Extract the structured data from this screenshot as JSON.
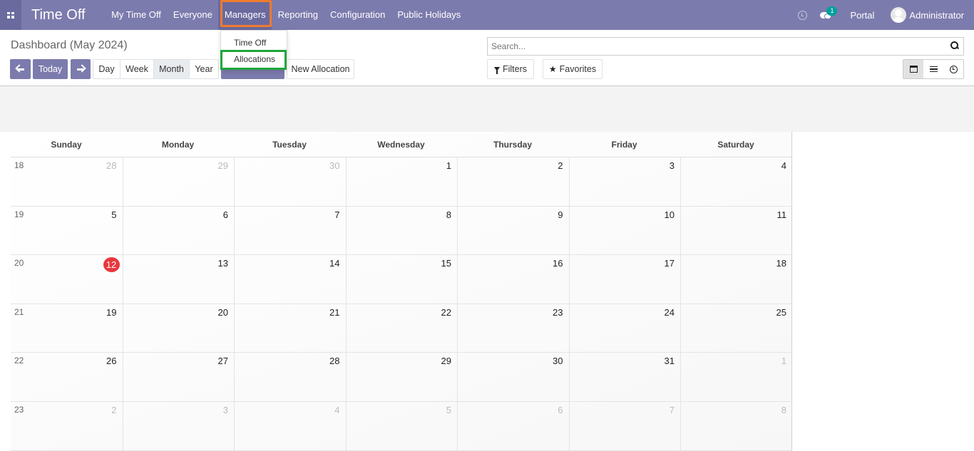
{
  "app": {
    "title": "Time Off"
  },
  "nav": {
    "menu": [
      "My Time Off",
      "Everyone",
      "Managers",
      "Reporting",
      "Configuration",
      "Public Holidays"
    ],
    "chat_count": "1",
    "portal": "Portal",
    "user": "Administrator"
  },
  "managers_menu": {
    "items": [
      "Time Off",
      "Allocations"
    ]
  },
  "control": {
    "breadcrumb": "Dashboard (May 2024)",
    "today": "Today",
    "scales": [
      "Day",
      "Week",
      "Month",
      "Year"
    ],
    "active_scale": "Month",
    "new_allocation": "New Allocation",
    "search_placeholder": "Search...",
    "filters": "Filters",
    "favorites": "Favorites"
  },
  "colors": {
    "nav": "#7c7bad",
    "today": "#e8373d",
    "managers_highlight": "#f07b2c",
    "allocations_highlight": "#1ea63a"
  },
  "calendar": {
    "day_names": [
      "Sunday",
      "Monday",
      "Tuesday",
      "Wednesday",
      "Thursday",
      "Friday",
      "Saturday"
    ],
    "today": "12",
    "weeks": [
      {
        "week": "18",
        "days": [
          "28",
          "29",
          "30",
          "1",
          "2",
          "3",
          "4"
        ],
        "muted": [
          true,
          true,
          true,
          false,
          false,
          false,
          false
        ]
      },
      {
        "week": "19",
        "days": [
          "5",
          "6",
          "7",
          "8",
          "9",
          "10",
          "11"
        ],
        "muted": [
          false,
          false,
          false,
          false,
          false,
          false,
          false
        ]
      },
      {
        "week": "20",
        "days": [
          "12",
          "13",
          "14",
          "15",
          "16",
          "17",
          "18"
        ],
        "muted": [
          false,
          false,
          false,
          false,
          false,
          false,
          false
        ]
      },
      {
        "week": "21",
        "days": [
          "19",
          "20",
          "21",
          "22",
          "23",
          "24",
          "25"
        ],
        "muted": [
          false,
          false,
          false,
          false,
          false,
          false,
          false
        ]
      },
      {
        "week": "22",
        "days": [
          "26",
          "27",
          "28",
          "29",
          "30",
          "31",
          "1"
        ],
        "muted": [
          false,
          false,
          false,
          false,
          false,
          false,
          true
        ]
      },
      {
        "week": "23",
        "days": [
          "2",
          "3",
          "4",
          "5",
          "6",
          "7",
          "8"
        ],
        "muted": [
          true,
          true,
          true,
          true,
          true,
          true,
          true
        ]
      }
    ]
  }
}
